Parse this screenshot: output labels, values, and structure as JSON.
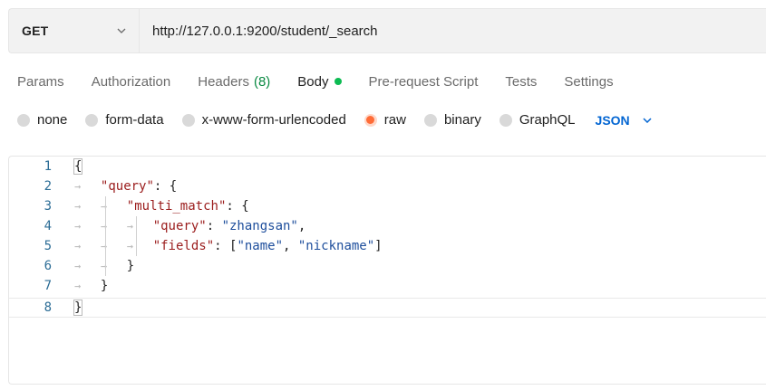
{
  "request": {
    "method": "GET",
    "url": "http://127.0.0.1:9200/student/_search"
  },
  "tabs": [
    {
      "label": "Params"
    },
    {
      "label": "Authorization"
    },
    {
      "label": "Headers",
      "count": "(8)"
    },
    {
      "label": "Body",
      "active": true
    },
    {
      "label": "Pre-request Script"
    },
    {
      "label": "Tests"
    },
    {
      "label": "Settings"
    }
  ],
  "body_types": [
    {
      "label": "none"
    },
    {
      "label": "form-data"
    },
    {
      "label": "x-www-form-urlencoded"
    },
    {
      "label": "raw",
      "checked": true
    },
    {
      "label": "binary"
    },
    {
      "label": "GraphQL"
    }
  ],
  "format": {
    "label": "JSON"
  },
  "editor": {
    "line_numbers": [
      "1",
      "2",
      "3",
      "4",
      "5",
      "6",
      "7",
      "8"
    ],
    "lines": [
      {
        "indent": 0,
        "text": "{"
      },
      {
        "indent": 1,
        "key": "\"query\"",
        "rest": ": {"
      },
      {
        "indent": 2,
        "key": "\"multi_match\"",
        "rest": ": {"
      },
      {
        "indent": 3,
        "key": "\"query\"",
        "sep": ": ",
        "value": "\"zhangsan\"",
        "tail": ","
      },
      {
        "indent": 3,
        "key": "\"fields\"",
        "sep": ": [",
        "value": "\"name\"",
        "mid": ", ",
        "value2": "\"nickname\"",
        "tail": "]"
      },
      {
        "indent": 2,
        "text": "}"
      },
      {
        "indent": 1,
        "text": "}"
      },
      {
        "indent": 0,
        "text": "}"
      }
    ]
  },
  "colors": {
    "key": "#9b1d1d",
    "string": "#1e4e9c",
    "accent": "#ff6c37",
    "format": "#0265d2",
    "status_dot": "#0cbb52"
  }
}
